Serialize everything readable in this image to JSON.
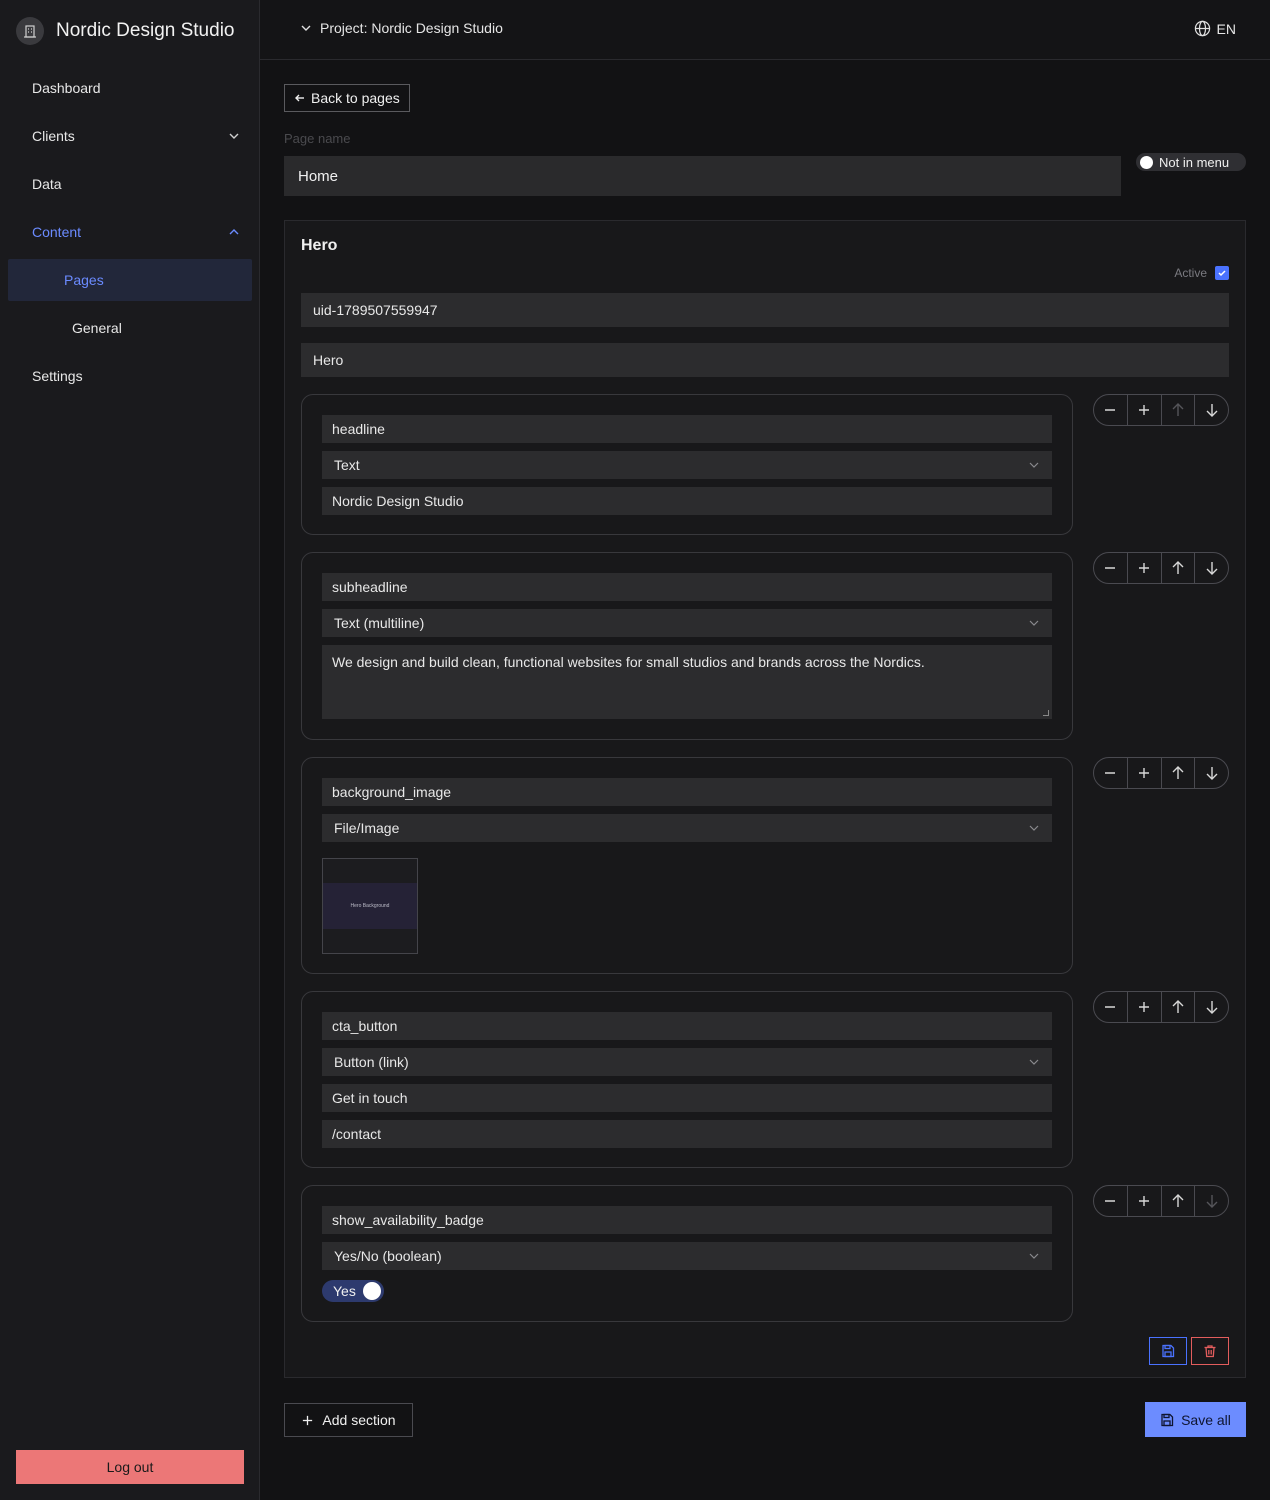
{
  "app": {
    "brand": "Nordic Design Studio"
  },
  "sidebar": {
    "items": [
      {
        "label": "Dashboard"
      },
      {
        "label": "Clients"
      },
      {
        "label": "Data"
      },
      {
        "label": "Content"
      },
      {
        "label": "Pages"
      },
      {
        "label": "General"
      },
      {
        "label": "Settings"
      }
    ],
    "logout_label": "Log out"
  },
  "topbar": {
    "project_label": "Project: Nordic Design Studio",
    "language": "EN"
  },
  "page": {
    "back_label": "Back to pages",
    "name_label": "Page name",
    "name_value": "Home",
    "menu_toggle_label": "Not in menu"
  },
  "section": {
    "title": "Hero",
    "active_label": "Active",
    "uid": "uid-1789507559947",
    "name": "Hero",
    "fields": [
      {
        "key": "headline",
        "type": "Text",
        "value": "Nordic Design Studio"
      },
      {
        "key": "subheadline",
        "type": "Text (multiline)",
        "value": "We design and build clean, functional websites for small studios and brands across the Nordics."
      },
      {
        "key": "background_image",
        "type": "File/Image",
        "image_caption": "Hero Background"
      },
      {
        "key": "cta_button",
        "type": "Button (link)",
        "label": "Get in touch",
        "url": "/contact"
      },
      {
        "key": "show_availability_badge",
        "type": "Yes/No (boolean)",
        "value": "Yes"
      }
    ]
  },
  "footer": {
    "add_section_label": "Add section",
    "save_all_label": "Save all"
  },
  "colors": {
    "accent": "#6c8cff",
    "danger": "#ec7777",
    "background": "#121214"
  }
}
